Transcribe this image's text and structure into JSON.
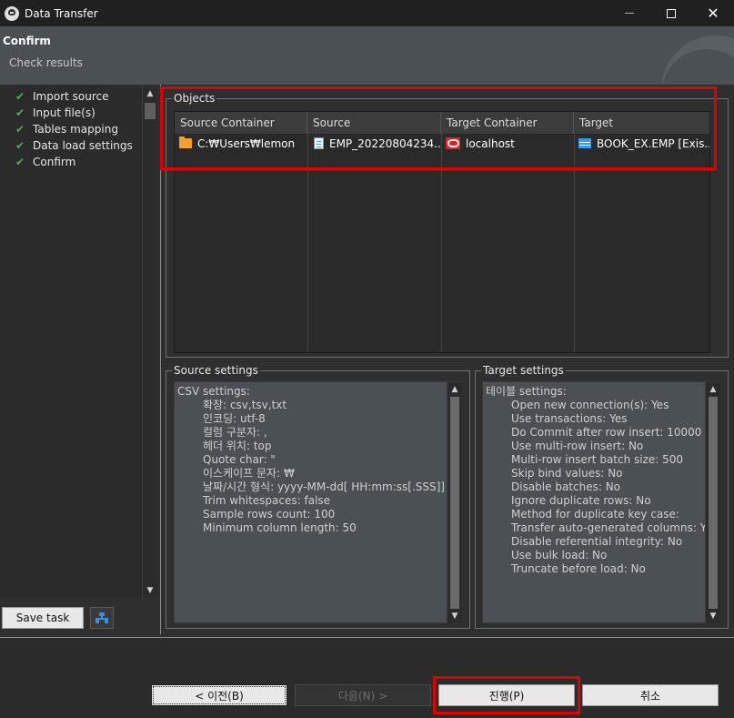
{
  "window": {
    "title": "Data Transfer"
  },
  "header": {
    "title": "Confirm",
    "subtitle": "Check results"
  },
  "nav": {
    "items": [
      {
        "label": "Import source",
        "done": true
      },
      {
        "label": "Input file(s)",
        "done": true
      },
      {
        "label": "Tables mapping",
        "done": true
      },
      {
        "label": "Data load settings",
        "done": true
      },
      {
        "label": "Confirm",
        "done": true
      }
    ],
    "check_glyph": "✔"
  },
  "left_buttons": {
    "save_task": "Save task"
  },
  "objects": {
    "legend": "Objects",
    "columns": [
      "Source Container",
      "Source",
      "Target Container",
      "Target"
    ],
    "rows": [
      {
        "source_container": "C:₩Users₩lemon",
        "source": "EMP_20220804234...",
        "target_container": "localhost",
        "target": "BOOK_EX.EMP [Exis..."
      }
    ]
  },
  "source_settings": {
    "legend": "Source settings",
    "lines": [
      {
        "text": "CSV settings:",
        "indent": false
      },
      {
        "text": "확장: csv,tsv,txt",
        "indent": true
      },
      {
        "text": "인코딩: utf-8",
        "indent": true
      },
      {
        "text": "컬럼 구분자: ,",
        "indent": true
      },
      {
        "text": "헤더 위치: top",
        "indent": true
      },
      {
        "text": "Quote char: \"",
        "indent": true
      },
      {
        "text": "이스케이프 문자: ₩",
        "indent": true
      },
      {
        "text": "날짜/시간 형식: yyyy-MM-dd[ HH:mm:ss[.SSS]]",
        "indent": true
      },
      {
        "text": "Trim whitespaces: false",
        "indent": true
      },
      {
        "text": "Sample rows count: 100",
        "indent": true
      },
      {
        "text": "Minimum column length: 50",
        "indent": true
      }
    ]
  },
  "target_settings": {
    "legend": "Target settings",
    "lines": [
      {
        "text": "테이블 settings:",
        "indent": false
      },
      {
        "text": "Open new connection(s): Yes",
        "indent": true
      },
      {
        "text": "Use transactions: Yes",
        "indent": true
      },
      {
        "text": "Do Commit after row insert: 10000",
        "indent": true
      },
      {
        "text": "Use multi-row insert: No",
        "indent": true
      },
      {
        "text": "Multi-row insert batch size: 500",
        "indent": true
      },
      {
        "text": "Skip bind values: No",
        "indent": true
      },
      {
        "text": "Disable batches: No",
        "indent": true
      },
      {
        "text": "Ignore duplicate rows: No",
        "indent": true
      },
      {
        "text": "Method for duplicate key case:",
        "indent": true
      },
      {
        "text": "Transfer auto-generated columns: Yes",
        "indent": true
      },
      {
        "text": "Disable referential integrity: No",
        "indent": true
      },
      {
        "text": "Use bulk load: No",
        "indent": true
      },
      {
        "text": "Truncate before load: No",
        "indent": true
      }
    ]
  },
  "footer": {
    "back": "< 이전(B)",
    "next": "다음(N) >",
    "proceed": "진행(P)",
    "cancel": "취소"
  },
  "colors": {
    "highlight": "#e00000",
    "check": "#4caf50",
    "header_bg": "#4b5054",
    "panel_bg": "#2f2f2f"
  },
  "icons": {
    "app": "dbeaver-beaver-icon",
    "source_container": "folder-icon",
    "source": "csv-file-icon",
    "target_container": "oracle-connection-icon",
    "target": "table-icon",
    "task": "task-config-icon"
  }
}
